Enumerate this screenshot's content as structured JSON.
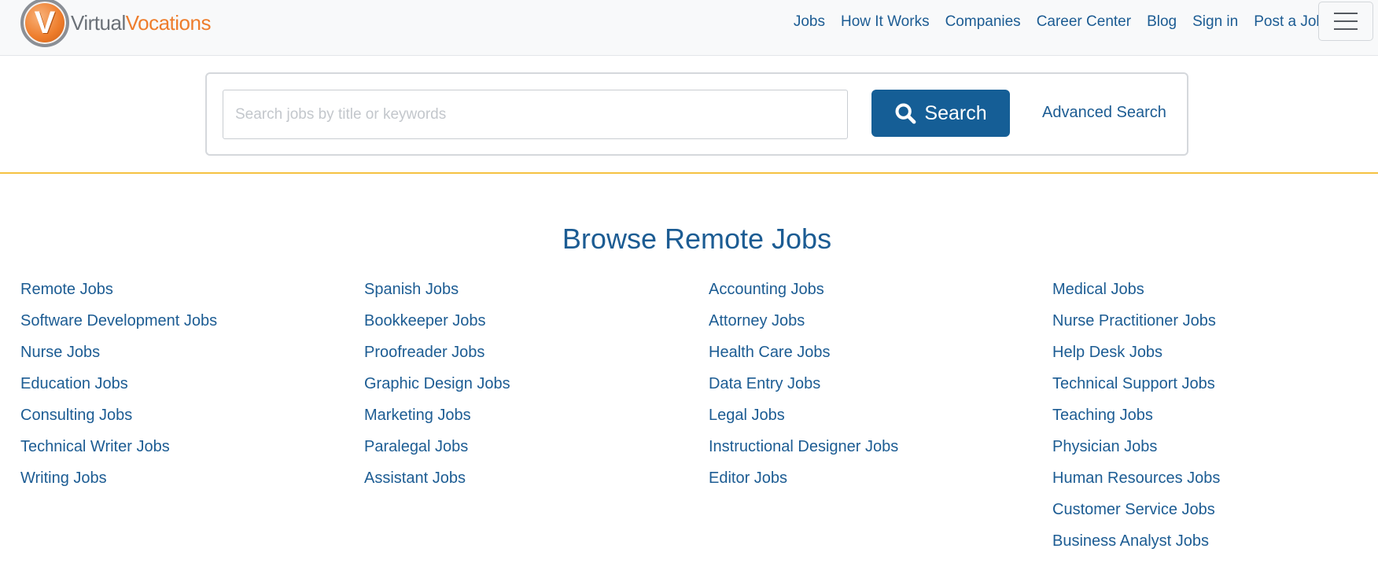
{
  "header": {
    "logo": {
      "text_part1": "Virtual",
      "text_part2": "Vocations",
      "mark_letter": "V"
    },
    "nav": [
      {
        "label": "Jobs"
      },
      {
        "label": "How It Works"
      },
      {
        "label": "Companies"
      },
      {
        "label": "Career Center"
      },
      {
        "label": "Blog"
      },
      {
        "label": "Sign in"
      },
      {
        "label": "Post a Job"
      }
    ],
    "menu_icon": "hamburger-icon"
  },
  "search": {
    "placeholder": "Search jobs by title or keywords",
    "value": "",
    "button_label": "Search",
    "button_icon": "search-icon",
    "advanced_label": "Advanced Search"
  },
  "browse": {
    "title": "Browse Remote Jobs",
    "columns": [
      [
        "Remote Jobs",
        "Software Development Jobs",
        "Nurse Jobs",
        "Education Jobs",
        "Consulting Jobs",
        "Technical Writer Jobs",
        "Writing Jobs"
      ],
      [
        "Spanish Jobs",
        "Bookkeeper Jobs",
        "Proofreader Jobs",
        "Graphic Design Jobs",
        "Marketing Jobs",
        "Paralegal Jobs",
        "Assistant Jobs"
      ],
      [
        "Accounting Jobs",
        "Attorney Jobs",
        "Health Care Jobs",
        "Data Entry Jobs",
        "Legal Jobs",
        "Instructional Designer Jobs",
        "Editor Jobs"
      ],
      [
        "Medical Jobs",
        "Nurse Practitioner Jobs",
        "Help Desk Jobs",
        "Technical Support Jobs",
        "Teaching Jobs",
        "Physician Jobs",
        "Human Resources Jobs",
        "Customer Service Jobs",
        "Business Analyst Jobs"
      ]
    ]
  },
  "colors": {
    "link": "#1c5c93",
    "button": "#155e96",
    "accent_line": "#f5c242",
    "logo_orange": "#ee7d2c",
    "logo_gray": "#6b7178"
  }
}
